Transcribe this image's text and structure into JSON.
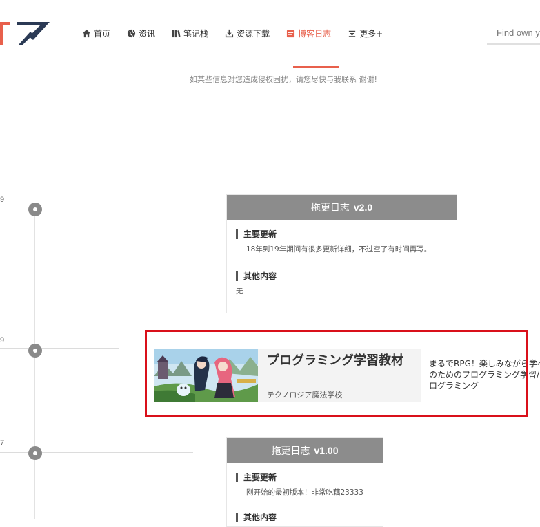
{
  "header": {
    "nav": [
      {
        "label": "首页",
        "icon": "home-icon"
      },
      {
        "label": "资讯",
        "icon": "globe-icon"
      },
      {
        "label": "笔记栈",
        "icon": "books-icon"
      },
      {
        "label": "资源下载",
        "icon": "download-icon"
      },
      {
        "label": "博客日志",
        "icon": "blog-icon",
        "active": true
      },
      {
        "label": "更多+",
        "icon": "more-icon"
      }
    ],
    "search_placeholder": "Find own you"
  },
  "notice": {
    "text": "如某些信息对您造成侵权困扰，请您尽快与我联系 谢谢!"
  },
  "timeline": {
    "dates": [
      "9",
      "9",
      "7"
    ]
  },
  "logs": [
    {
      "title": "拖更日志",
      "version": "v2.0",
      "sections": [
        {
          "heading": "主要更新",
          "text": "18年到19年期间有很多更新详细，不过空了有时间再写。"
        },
        {
          "heading": "其他内容",
          "text": "无"
        }
      ]
    },
    {
      "title": "拖更日志",
      "version": "v1.00",
      "sections": [
        {
          "heading": "主要更新",
          "text": "刚开始的最初版本！非常吃藕23333"
        },
        {
          "heading": "其他内容",
          "text": ""
        }
      ]
    }
  ],
  "ad": {
    "title": "プログラミング学習教材",
    "subtitle": "テクノロジア魔法学校",
    "description": "まるでRPG！楽しみながら学べるつく大人のためのプログラミング学習/ディズニープログラミング"
  },
  "colors": {
    "accent": "#e8604c",
    "card_header": "#8c8c8c",
    "highlight": "#d9101a"
  }
}
